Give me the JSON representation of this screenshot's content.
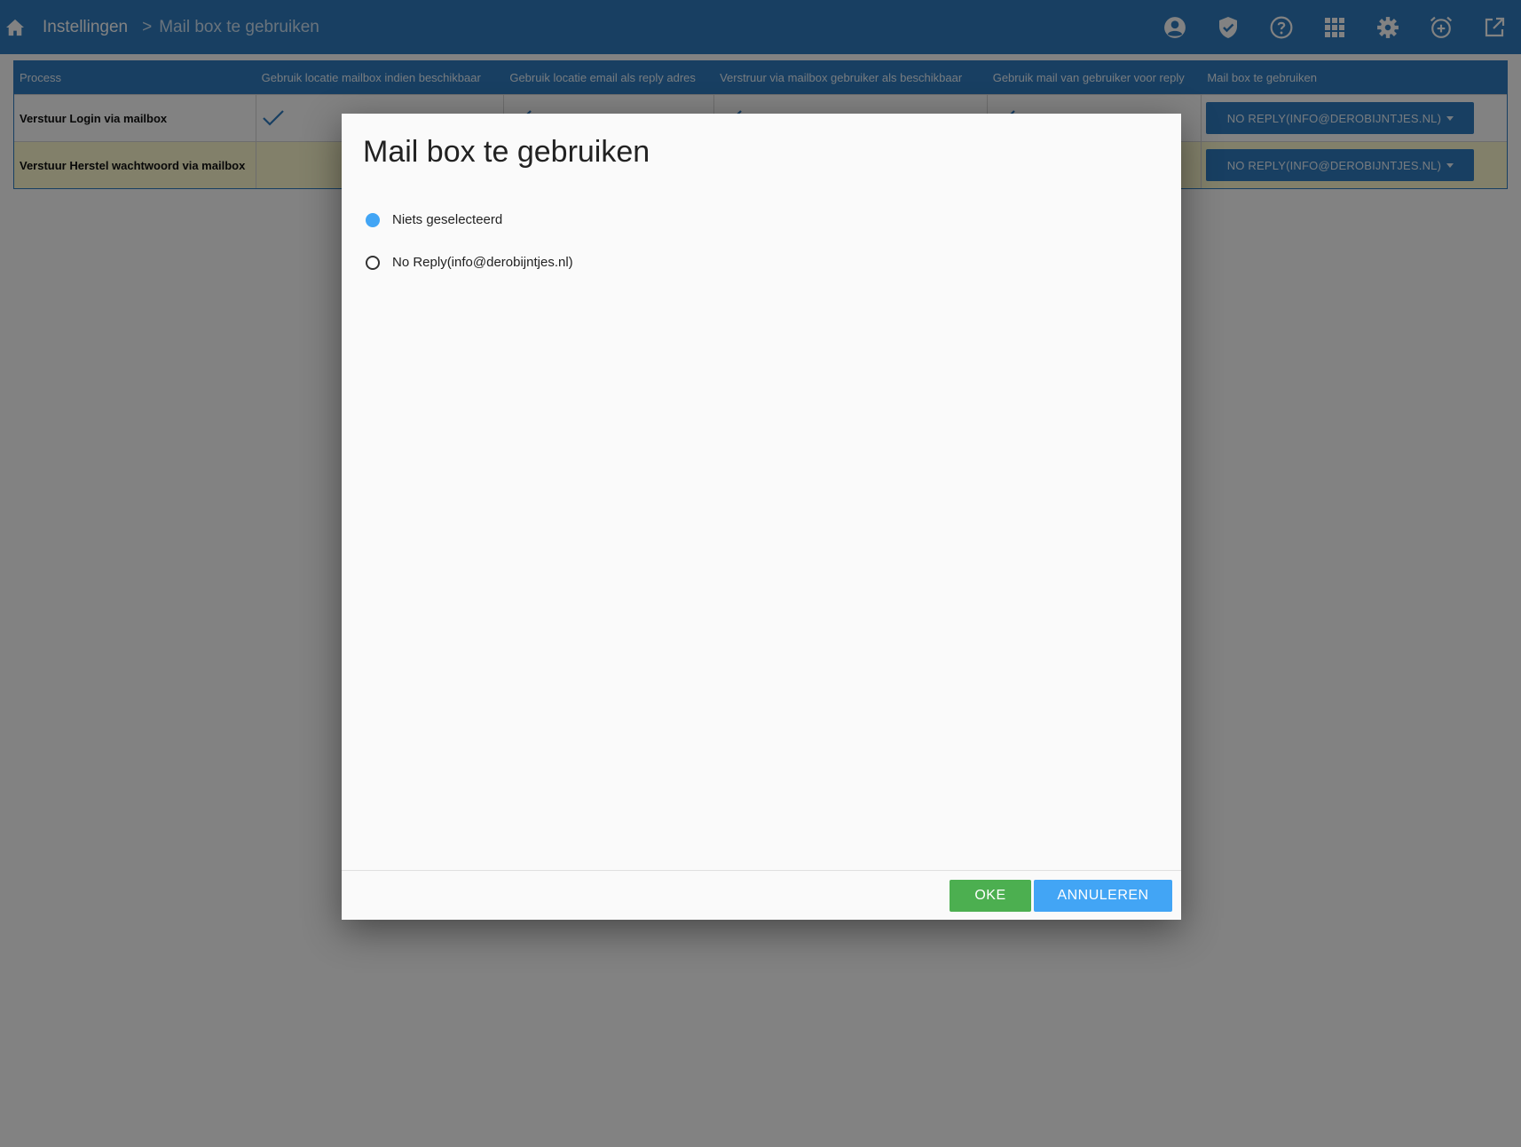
{
  "breadcrumb": {
    "root": "Instellingen",
    "separator": ">",
    "current": "Mail box te gebruiken"
  },
  "toolbar": {
    "icons": [
      "account-icon",
      "shield-check-icon",
      "help-icon",
      "apps-grid-icon",
      "settings-gear-icon",
      "alarm-add-icon",
      "open-external-icon"
    ]
  },
  "table": {
    "headers": [
      "Process",
      "Gebruik locatie mailbox indien beschikbaar",
      "Gebruik locatie email als reply adres",
      "Verstruur via mailbox gebruiker als beschikbaar",
      "Gebruik mail van gebruiker voor reply",
      "Mail box te gebruiken"
    ],
    "rows": [
      {
        "process": "Verstuur Login via mailbox",
        "use_location_mailbox": true,
        "use_location_email_reply": true,
        "send_via_user_mailbox": true,
        "use_user_mail_reply": true,
        "mailbox": "NO REPLY(INFO@DEROBIJNTJES.NL)"
      },
      {
        "process": "Verstuur Herstel wachtwoord via mailbox",
        "use_location_mailbox": false,
        "use_location_email_reply": false,
        "send_via_user_mailbox": false,
        "use_user_mail_reply": false,
        "mailbox": "NO REPLY(INFO@DEROBIJNTJES.NL)"
      }
    ]
  },
  "dialog": {
    "title": "Mail box te gebruiken",
    "options": [
      {
        "label": "Niets geselecteerd",
        "selected": true
      },
      {
        "label": "No Reply(info@derobijntjes.nl)",
        "selected": false
      }
    ],
    "ok_label": "OKE",
    "cancel_label": "ANNULEREN"
  },
  "colors": {
    "primary": "#2f7dc1",
    "ok": "#4caf50",
    "cancel": "#42a5f5",
    "row_highlight": "#fffbd0"
  }
}
